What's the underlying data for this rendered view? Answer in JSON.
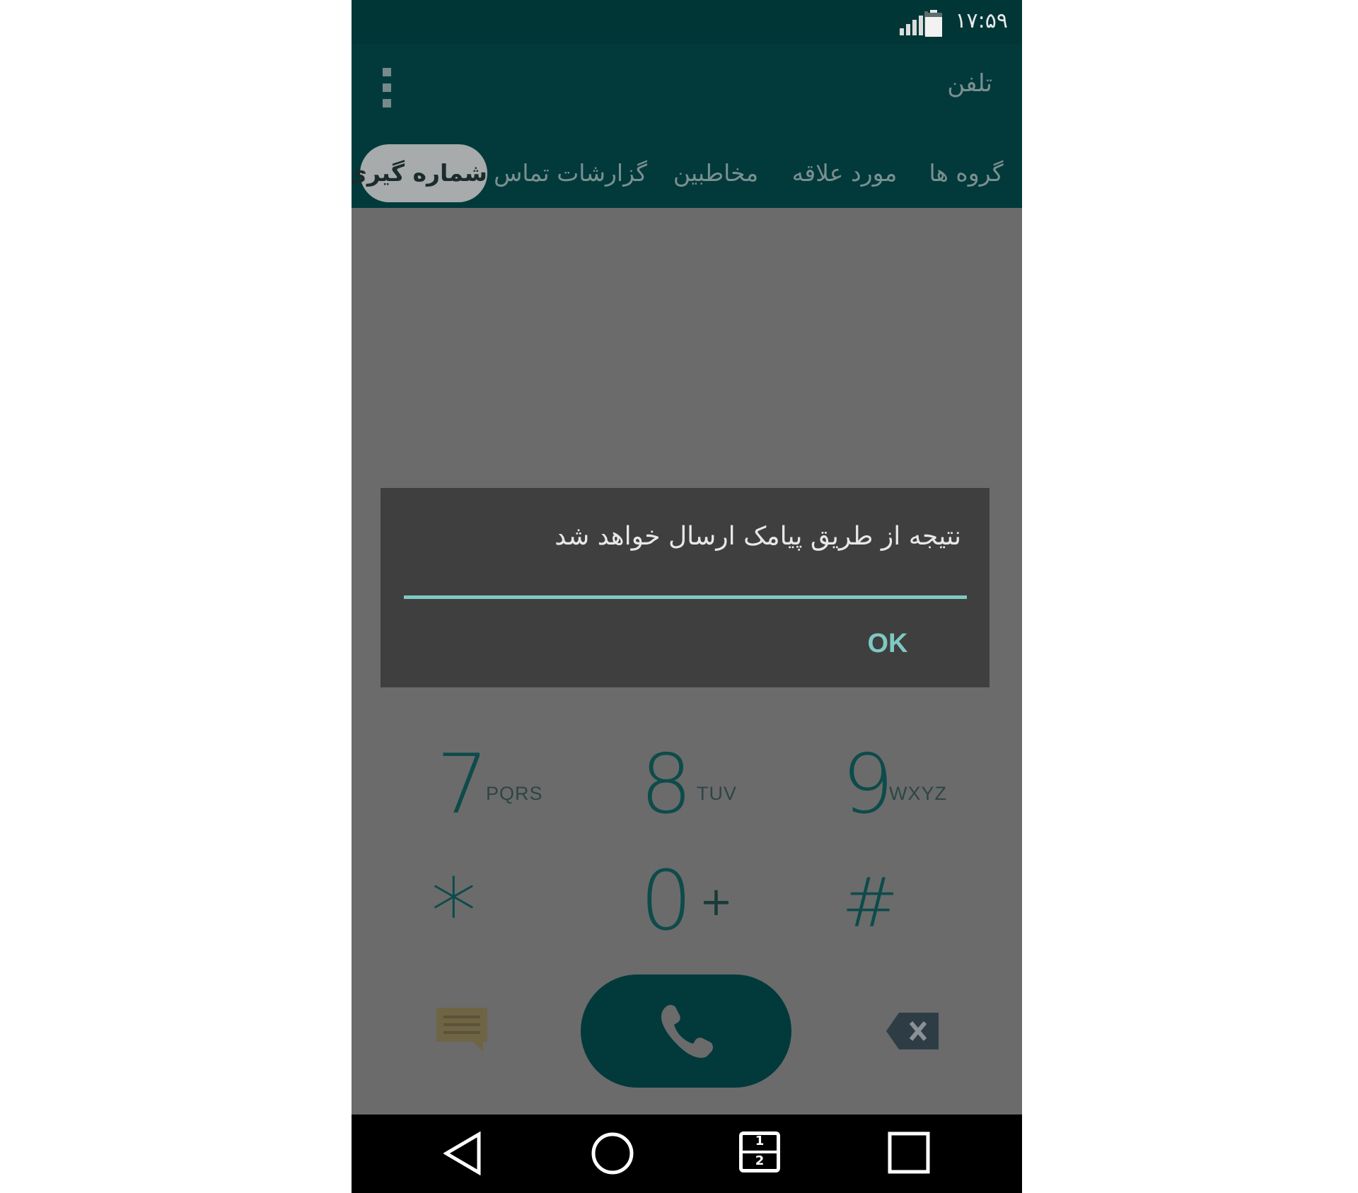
{
  "status_bar": {
    "time": "۱۷:۵۹",
    "signal_icon": "signal-bars-icon",
    "battery_icon": "battery-icon"
  },
  "action_bar": {
    "title": "تلفن",
    "overflow_icon": "more-vert-icon"
  },
  "tabs": [
    {
      "label": "گروه ها"
    },
    {
      "label": "مورد علاقه"
    },
    {
      "label": "مخاطبین"
    },
    {
      "label": "گزارشات تماس"
    },
    {
      "label": "شماره گیری",
      "active": true
    }
  ],
  "dialog": {
    "message": "نتیجه از طریق پیامک ارسال خواهد شد",
    "ok_label": "OK"
  },
  "dialpad": {
    "keys": [
      {
        "digit": "7",
        "letters": "PQRS"
      },
      {
        "digit": "8",
        "letters": "TUV"
      },
      {
        "digit": "9",
        "letters": "WXYZ"
      },
      {
        "digit": "*"
      },
      {
        "digit": "0",
        "sub": "+"
      },
      {
        "digit": "#"
      }
    ],
    "message_icon": "message-icon",
    "call_icon": "phone-icon",
    "backspace_icon": "backspace-icon"
  },
  "nav_bar": {
    "back_icon": "back-icon",
    "home_icon": "home-icon",
    "dual_window_icon": "dual-window-icon",
    "recents_icon": "recents-icon",
    "dual_window_digits": [
      "1",
      "2"
    ]
  },
  "colors": {
    "header": "#023a3c",
    "accent": "#7fc8c3",
    "scrim": "#6b6b6b",
    "dialog": "#3f3f3f",
    "navbar": "#000000"
  }
}
